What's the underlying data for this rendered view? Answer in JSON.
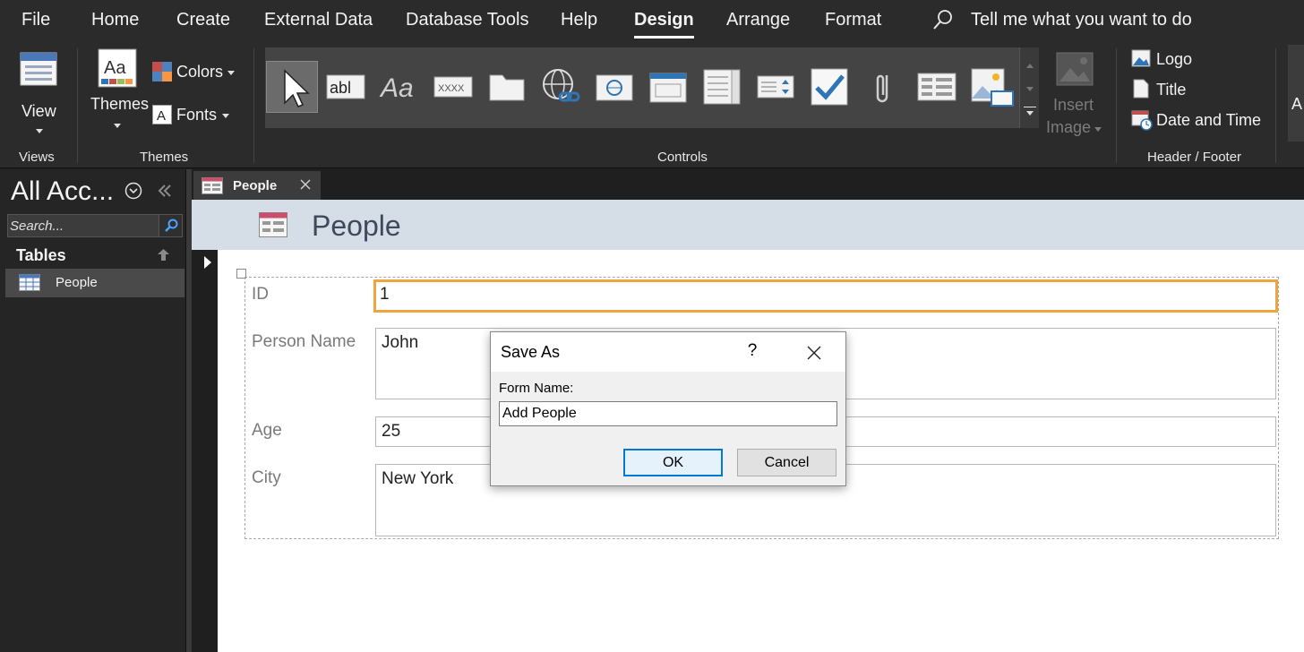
{
  "menu": {
    "tabs": [
      "File",
      "Home",
      "Create",
      "External Data",
      "Database Tools",
      "Help",
      "Design",
      "Arrange",
      "Format"
    ],
    "active_tab": "Design",
    "tell_me": "Tell me what you want to do"
  },
  "ribbon": {
    "views": {
      "view_label": "View",
      "group_label": "Views"
    },
    "themes": {
      "themes_label": "Themes",
      "colors_label": "Colors",
      "fonts_label": "Fonts",
      "group_label": "Themes"
    },
    "controls": {
      "group_label": "Controls",
      "insert_image_line1": "Insert",
      "insert_image_line2": "Image"
    },
    "header_footer": {
      "logo_label": "Logo",
      "title_label": "Title",
      "date_time_label": "Date and Time",
      "group_label": "Header / Footer"
    },
    "cut_off_label": "A"
  },
  "nav": {
    "title": "All Acc...",
    "search_placeholder": "Search...",
    "section": "Tables",
    "items": [
      {
        "label": "People"
      }
    ]
  },
  "document": {
    "tab_label": "People",
    "form_title": "People",
    "fields": [
      {
        "label": "ID",
        "value": "1"
      },
      {
        "label": "Person Name",
        "value": "John"
      },
      {
        "label": "Age",
        "value": "25"
      },
      {
        "label": "City",
        "value": "New York"
      }
    ]
  },
  "dialog": {
    "title": "Save As",
    "help": "?",
    "field_label": "Form Name:",
    "field_value": "Add People",
    "ok_label": "OK",
    "cancel_label": "Cancel"
  },
  "colors": {
    "active_field_border": "#f0a43c",
    "form_header_bg": "#d5dde7",
    "default_button_border": "#0078d7"
  }
}
